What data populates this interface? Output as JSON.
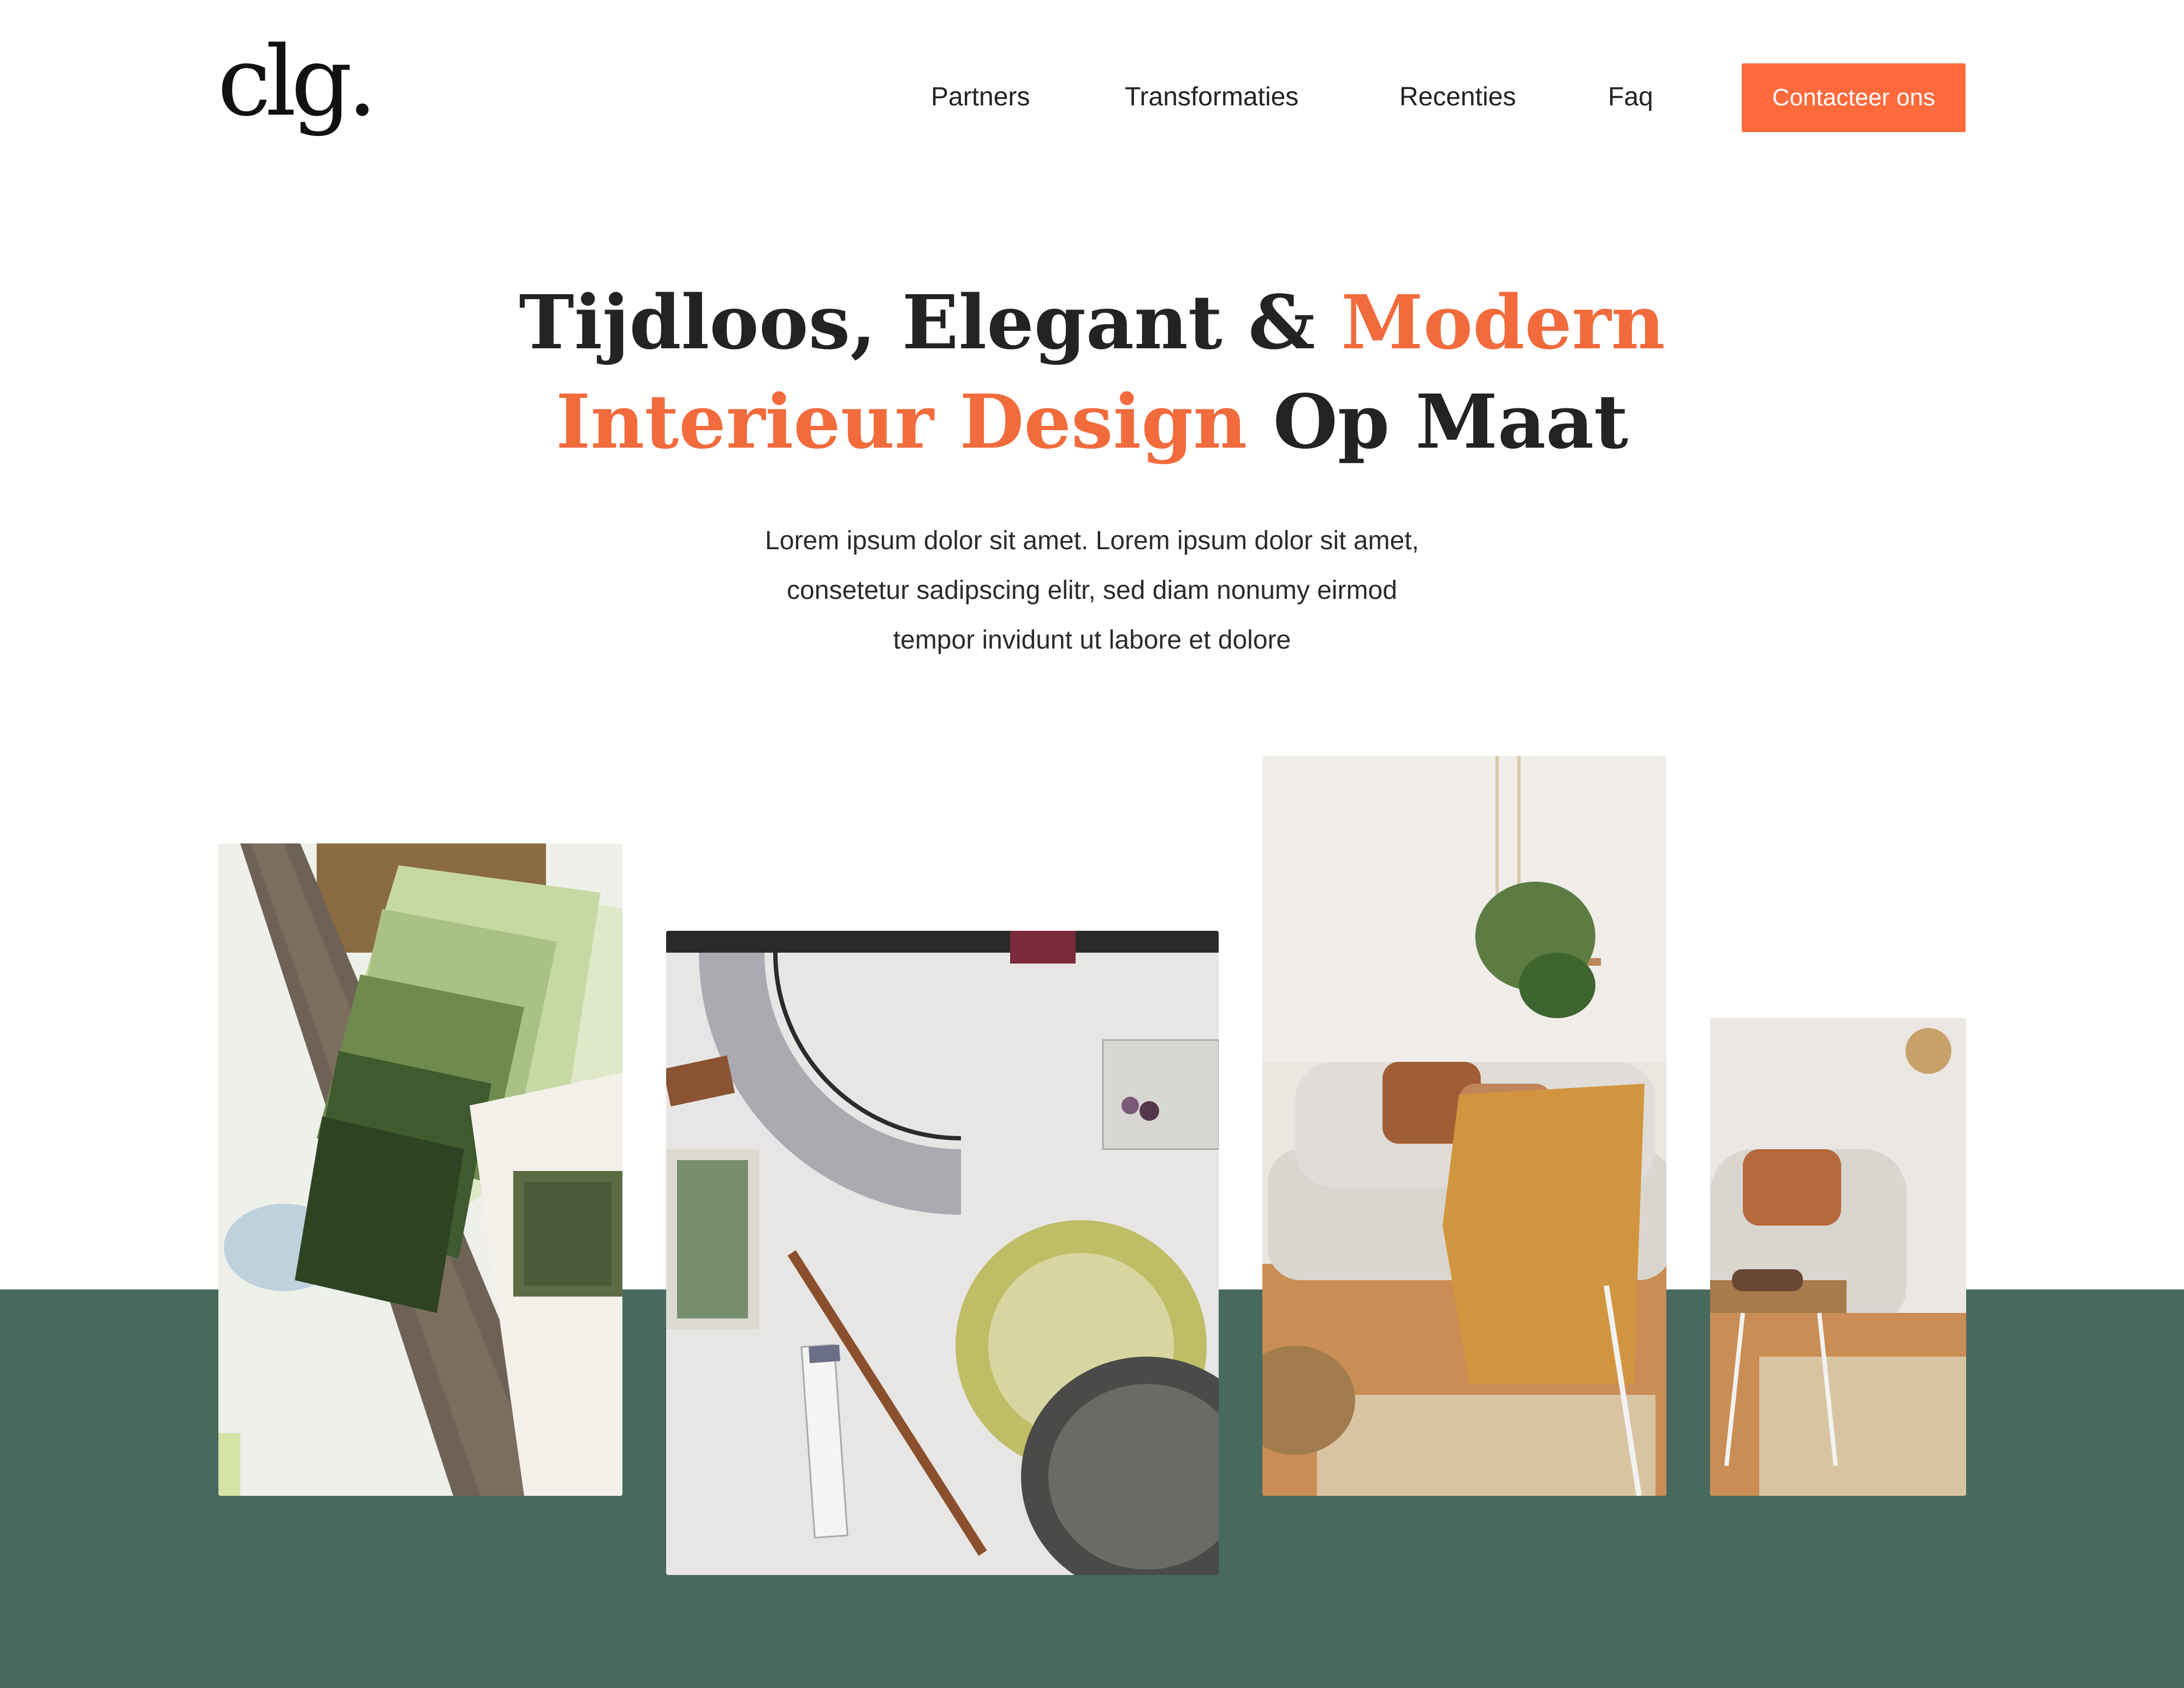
{
  "brand": {
    "logo_text": "clg.",
    "accent_color": "#fe6a3b",
    "band_color": "#48695e"
  },
  "nav": {
    "items": [
      {
        "label": "Partners"
      },
      {
        "label": "Transformaties"
      },
      {
        "label": "Recenties"
      },
      {
        "label": "Faq"
      }
    ],
    "cta_label": "Contacteer ons"
  },
  "hero": {
    "title_part1": "Tijdloos, Elegant & ",
    "title_accent1": "Modern",
    "title_accent2": "Interieur Design",
    "title_part2": " Op Maat",
    "subtitle_line1": "Lorem ipsum dolor sit amet. Lorem ipsum dolor sit amet,",
    "subtitle_line2": "consetetur sadipscing elitr, sed diam nonumy eirmod",
    "subtitle_line3": "tempor invidunt ut labore et dolore"
  },
  "gallery": {
    "images": [
      {
        "subject": "paint-swatches-wood-sample"
      },
      {
        "subject": "floor-plan-sketch-with-rug"
      },
      {
        "subject": "living-room-sofa"
      },
      {
        "subject": "armchair-coffee-table"
      }
    ]
  }
}
